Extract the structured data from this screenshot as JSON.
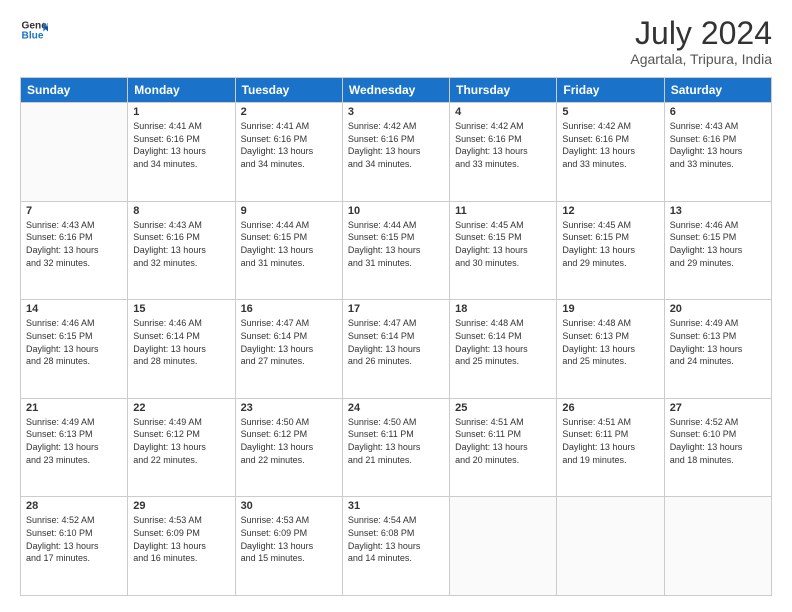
{
  "logo": {
    "line1": "General",
    "line2": "Blue"
  },
  "title": "July 2024",
  "subtitle": "Agartala, Tripura, India",
  "days_header": [
    "Sunday",
    "Monday",
    "Tuesday",
    "Wednesday",
    "Thursday",
    "Friday",
    "Saturday"
  ],
  "weeks": [
    [
      {
        "day": "",
        "info": ""
      },
      {
        "day": "1",
        "info": "Sunrise: 4:41 AM\nSunset: 6:16 PM\nDaylight: 13 hours\nand 34 minutes."
      },
      {
        "day": "2",
        "info": "Sunrise: 4:41 AM\nSunset: 6:16 PM\nDaylight: 13 hours\nand 34 minutes."
      },
      {
        "day": "3",
        "info": "Sunrise: 4:42 AM\nSunset: 6:16 PM\nDaylight: 13 hours\nand 34 minutes."
      },
      {
        "day": "4",
        "info": "Sunrise: 4:42 AM\nSunset: 6:16 PM\nDaylight: 13 hours\nand 33 minutes."
      },
      {
        "day": "5",
        "info": "Sunrise: 4:42 AM\nSunset: 6:16 PM\nDaylight: 13 hours\nand 33 minutes."
      },
      {
        "day": "6",
        "info": "Sunrise: 4:43 AM\nSunset: 6:16 PM\nDaylight: 13 hours\nand 33 minutes."
      }
    ],
    [
      {
        "day": "7",
        "info": "Sunrise: 4:43 AM\nSunset: 6:16 PM\nDaylight: 13 hours\nand 32 minutes."
      },
      {
        "day": "8",
        "info": "Sunrise: 4:43 AM\nSunset: 6:16 PM\nDaylight: 13 hours\nand 32 minutes."
      },
      {
        "day": "9",
        "info": "Sunrise: 4:44 AM\nSunset: 6:15 PM\nDaylight: 13 hours\nand 31 minutes."
      },
      {
        "day": "10",
        "info": "Sunrise: 4:44 AM\nSunset: 6:15 PM\nDaylight: 13 hours\nand 31 minutes."
      },
      {
        "day": "11",
        "info": "Sunrise: 4:45 AM\nSunset: 6:15 PM\nDaylight: 13 hours\nand 30 minutes."
      },
      {
        "day": "12",
        "info": "Sunrise: 4:45 AM\nSunset: 6:15 PM\nDaylight: 13 hours\nand 29 minutes."
      },
      {
        "day": "13",
        "info": "Sunrise: 4:46 AM\nSunset: 6:15 PM\nDaylight: 13 hours\nand 29 minutes."
      }
    ],
    [
      {
        "day": "14",
        "info": "Sunrise: 4:46 AM\nSunset: 6:15 PM\nDaylight: 13 hours\nand 28 minutes."
      },
      {
        "day": "15",
        "info": "Sunrise: 4:46 AM\nSunset: 6:14 PM\nDaylight: 13 hours\nand 28 minutes."
      },
      {
        "day": "16",
        "info": "Sunrise: 4:47 AM\nSunset: 6:14 PM\nDaylight: 13 hours\nand 27 minutes."
      },
      {
        "day": "17",
        "info": "Sunrise: 4:47 AM\nSunset: 6:14 PM\nDaylight: 13 hours\nand 26 minutes."
      },
      {
        "day": "18",
        "info": "Sunrise: 4:48 AM\nSunset: 6:14 PM\nDaylight: 13 hours\nand 25 minutes."
      },
      {
        "day": "19",
        "info": "Sunrise: 4:48 AM\nSunset: 6:13 PM\nDaylight: 13 hours\nand 25 minutes."
      },
      {
        "day": "20",
        "info": "Sunrise: 4:49 AM\nSunset: 6:13 PM\nDaylight: 13 hours\nand 24 minutes."
      }
    ],
    [
      {
        "day": "21",
        "info": "Sunrise: 4:49 AM\nSunset: 6:13 PM\nDaylight: 13 hours\nand 23 minutes."
      },
      {
        "day": "22",
        "info": "Sunrise: 4:49 AM\nSunset: 6:12 PM\nDaylight: 13 hours\nand 22 minutes."
      },
      {
        "day": "23",
        "info": "Sunrise: 4:50 AM\nSunset: 6:12 PM\nDaylight: 13 hours\nand 22 minutes."
      },
      {
        "day": "24",
        "info": "Sunrise: 4:50 AM\nSunset: 6:11 PM\nDaylight: 13 hours\nand 21 minutes."
      },
      {
        "day": "25",
        "info": "Sunrise: 4:51 AM\nSunset: 6:11 PM\nDaylight: 13 hours\nand 20 minutes."
      },
      {
        "day": "26",
        "info": "Sunrise: 4:51 AM\nSunset: 6:11 PM\nDaylight: 13 hours\nand 19 minutes."
      },
      {
        "day": "27",
        "info": "Sunrise: 4:52 AM\nSunset: 6:10 PM\nDaylight: 13 hours\nand 18 minutes."
      }
    ],
    [
      {
        "day": "28",
        "info": "Sunrise: 4:52 AM\nSunset: 6:10 PM\nDaylight: 13 hours\nand 17 minutes."
      },
      {
        "day": "29",
        "info": "Sunrise: 4:53 AM\nSunset: 6:09 PM\nDaylight: 13 hours\nand 16 minutes."
      },
      {
        "day": "30",
        "info": "Sunrise: 4:53 AM\nSunset: 6:09 PM\nDaylight: 13 hours\nand 15 minutes."
      },
      {
        "day": "31",
        "info": "Sunrise: 4:54 AM\nSunset: 6:08 PM\nDaylight: 13 hours\nand 14 minutes."
      },
      {
        "day": "",
        "info": ""
      },
      {
        "day": "",
        "info": ""
      },
      {
        "day": "",
        "info": ""
      }
    ]
  ]
}
